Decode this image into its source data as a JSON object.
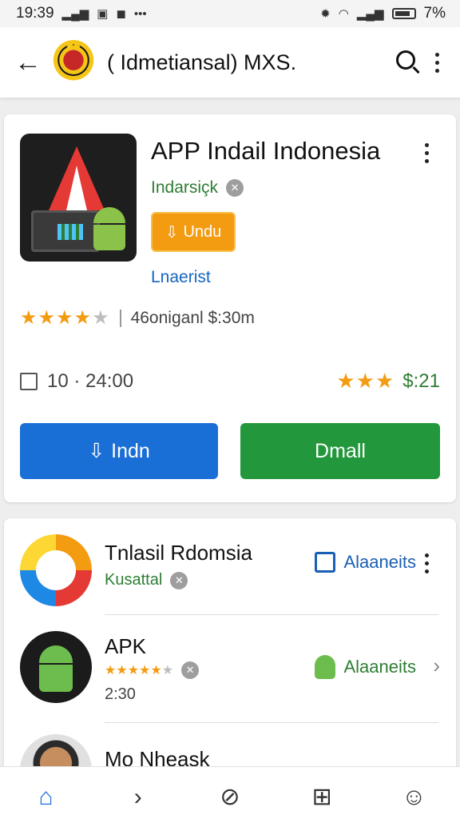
{
  "status_bar": {
    "time": "19:39",
    "battery_text": "7%"
  },
  "app_bar": {
    "title": "( Idmetiansal) ΜXS."
  },
  "featured_app": {
    "title": "APP Indail Indonesia",
    "developer": "Indarsiçk",
    "install_chip_label": "Undu",
    "sub_link": "Lnaerist",
    "rating_stars": 4,
    "rating_max": 5,
    "meta": "46oniganl $:30m",
    "downloads": "10 · 24:00",
    "secondary_stars": 3,
    "secondary_value": "$:21",
    "primary_button": "Indn",
    "secondary_button": "Dmall"
  },
  "list_items": [
    {
      "title": "Tnlasil Rdomsia",
      "subtitle": "Kusattal",
      "action": "Alaaneits"
    },
    {
      "title": "APK",
      "subtitle_stars": 4,
      "subtitle_time": "2:30",
      "action": "Alaaneits"
    },
    {
      "title": "Mo Nheask"
    }
  ],
  "colors": {
    "primary_blue": "#1a6fd6",
    "primary_green": "#23973b",
    "accent_orange": "#f39c12",
    "developer_green": "#2e7d32"
  }
}
